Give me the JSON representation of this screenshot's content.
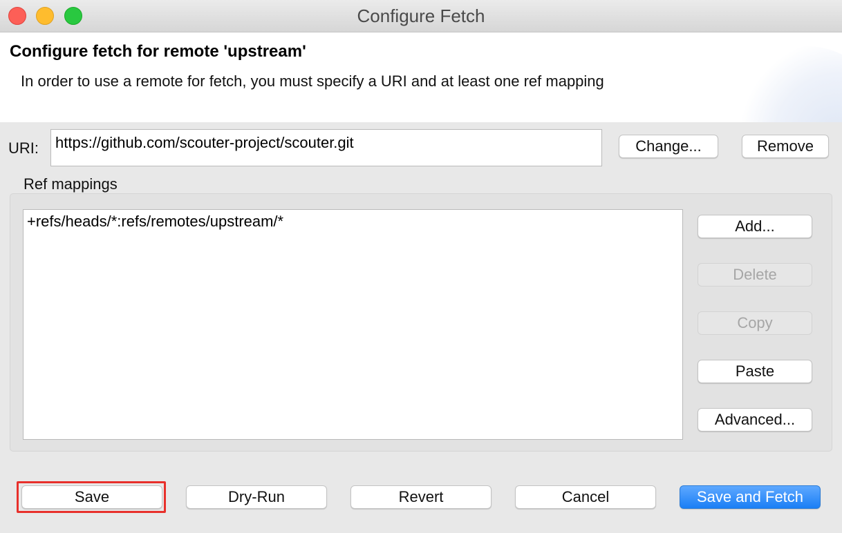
{
  "window": {
    "title": "Configure Fetch"
  },
  "banner": {
    "title": "Configure fetch for remote 'upstream'",
    "description": "In order to use a remote for fetch, you must specify a URI and at least one ref mapping"
  },
  "uri": {
    "label": "URI:",
    "value": "https://github.com/scouter-project/scouter.git",
    "change_label": "Change...",
    "remove_label": "Remove"
  },
  "ref_mappings": {
    "label": "Ref mappings",
    "items": [
      "+refs/heads/*:refs/remotes/upstream/*"
    ],
    "buttons": {
      "add": "Add...",
      "delete": "Delete",
      "copy": "Copy",
      "paste": "Paste",
      "advanced": "Advanced..."
    }
  },
  "footer": {
    "save": "Save",
    "dry_run": "Dry-Run",
    "revert": "Revert",
    "cancel": "Cancel",
    "save_and_fetch": "Save and Fetch"
  },
  "colors": {
    "primary_button": "#1a7ff5",
    "highlight_border": "#e8302b",
    "traffic_close": "#fd5f57",
    "traffic_minimize": "#febc2e",
    "traffic_maximize": "#29c840"
  }
}
